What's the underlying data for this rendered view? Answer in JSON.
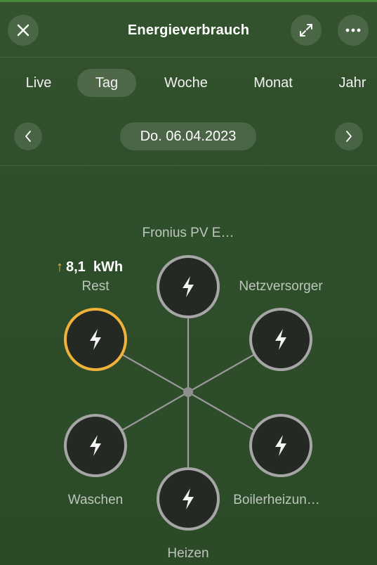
{
  "header": {
    "title": "Energieverbrauch"
  },
  "tabs": [
    {
      "label": "Live"
    },
    {
      "label": "Tag"
    },
    {
      "label": "Woche"
    },
    {
      "label": "Monat"
    },
    {
      "label": "Jahr"
    }
  ],
  "active_tab": "Tag",
  "date": {
    "label": "Do. 06.04.2023"
  },
  "rest_value": "8,1  kWh",
  "nodes": [
    {
      "label": "Fronius PV E…"
    },
    {
      "label": "Rest"
    },
    {
      "label": "Netzversorger"
    },
    {
      "label": "Waschen"
    },
    {
      "label": "Boilerheizun…"
    },
    {
      "label": "Heizen"
    }
  ],
  "icons": {
    "close": "close-icon",
    "expand": "expand-icon",
    "more": "more-icon",
    "prev": "chevron-left-icon",
    "next": "chevron-right-icon",
    "node": "lightning-icon",
    "trend": "arrow-up-icon"
  },
  "colors": {
    "accent": "#f0b23a",
    "node_fill": "#242a23",
    "node_border": "#a6a6a6",
    "line": "#9a9a9a"
  }
}
